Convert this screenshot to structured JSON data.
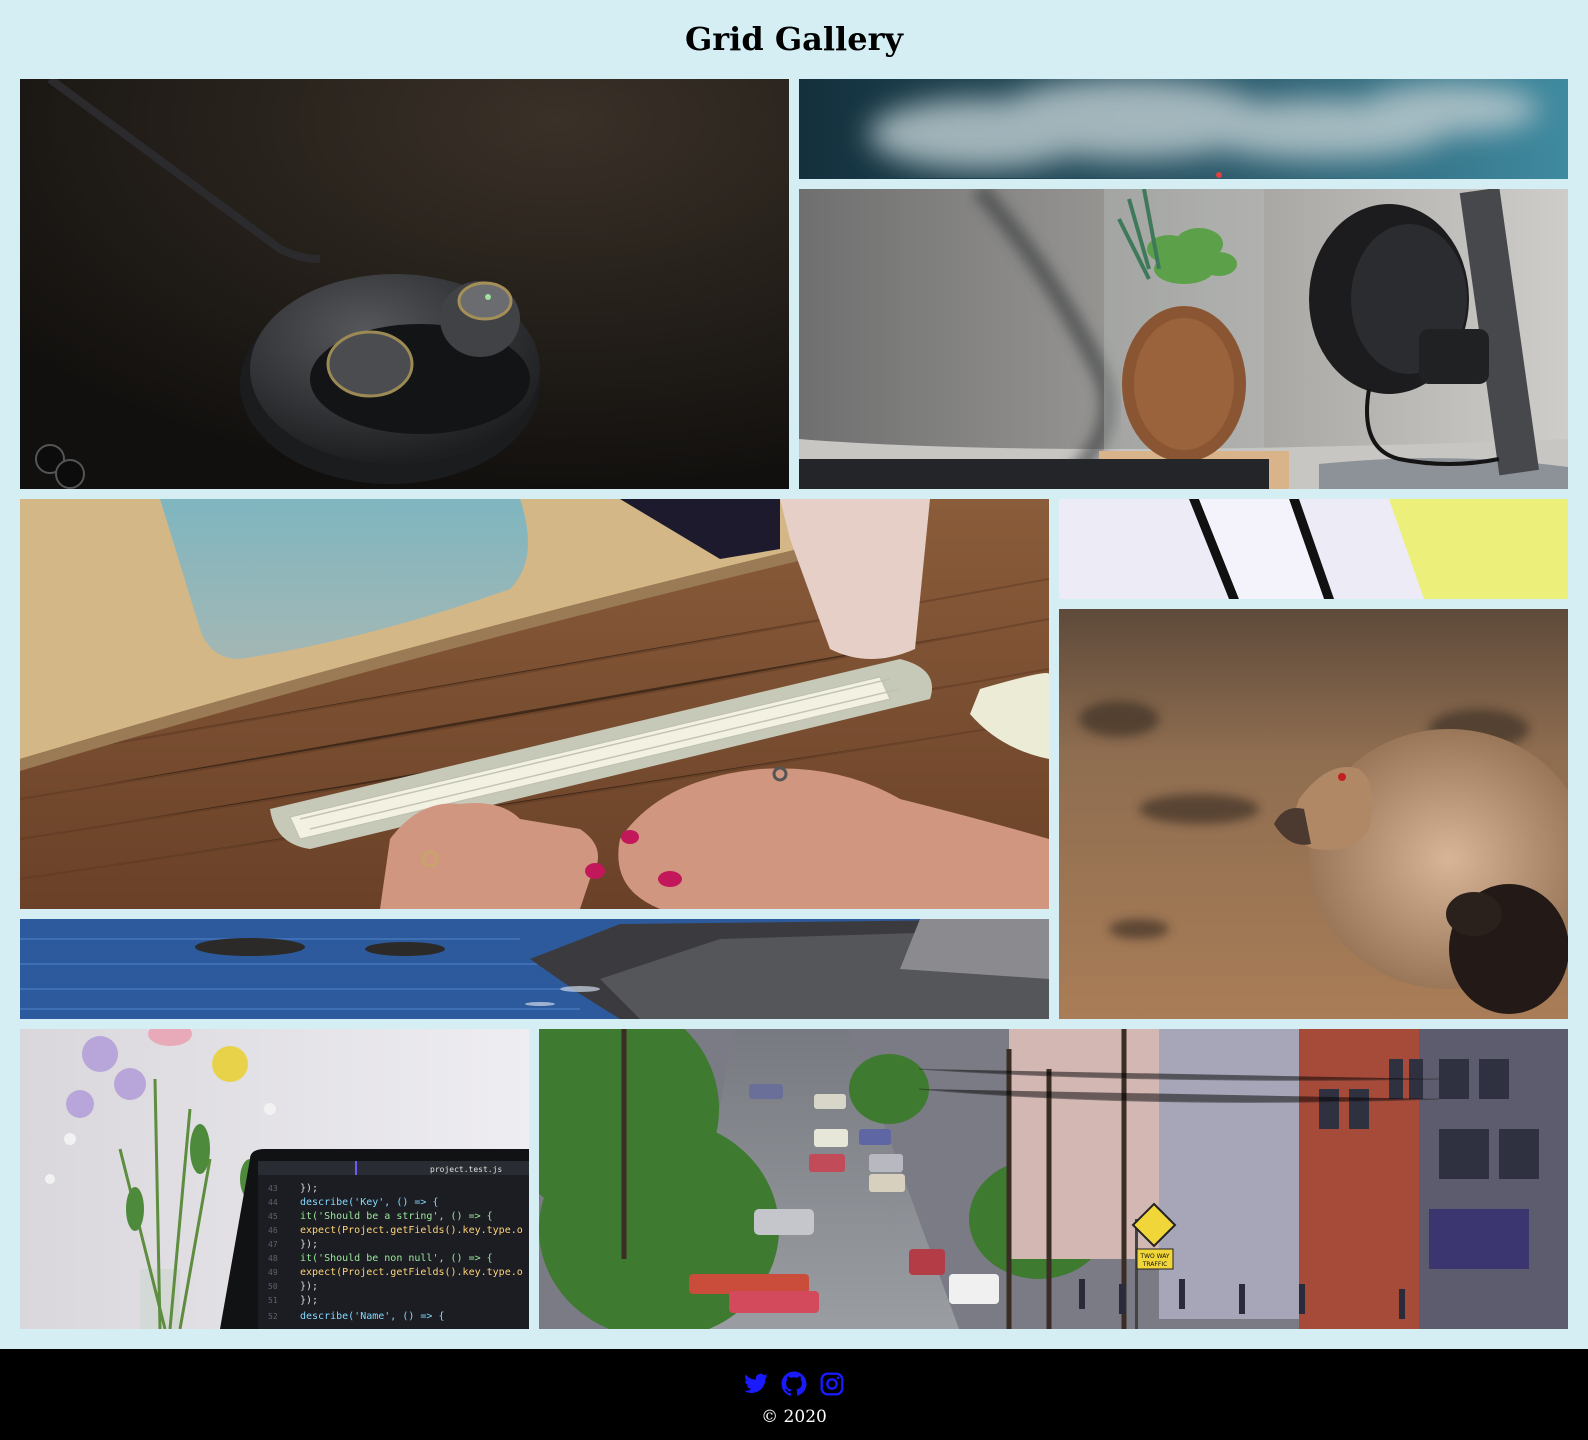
{
  "header": {
    "title": "Grid Gallery"
  },
  "gallery": {
    "tiles": [
      {
        "name": "earbuds-photo",
        "description": "wireless earbuds charging case"
      },
      {
        "name": "smoke-photo",
        "description": "smoke over dark teal background"
      },
      {
        "name": "headphones-plant-photo",
        "description": "headphones on stand beside plant terrarium"
      },
      {
        "name": "keyboard-typing-photo",
        "description": "hands typing on white keyboard on wooden desk"
      },
      {
        "name": "phone-photo",
        "description": "phones on white surface with yellow accent"
      },
      {
        "name": "sheep-photo",
        "description": "woolly sheep in brown field"
      },
      {
        "name": "coast-photo",
        "description": "rocky coastline and blue sea"
      },
      {
        "name": "laptop-code-photo",
        "description": "laptop showing code next to flowers"
      },
      {
        "name": "street-photo",
        "description": "steep city street with cars and houses"
      }
    ],
    "code_lines": [
      "});",
      "describe('Key', () => {",
      "  it('Should be a string', () => {",
      "    expect(Project.getFields().key.type.o",
      "  });",
      "  it('Should be non null', () => {",
      "    expect(Project.getFields().key.type.o",
      "  });",
      "});",
      "describe('Name', () => {"
    ],
    "code_tab": "project.test.js",
    "sign_text": [
      "TWO WAY",
      "TRAFFIC"
    ]
  },
  "footer": {
    "social": [
      {
        "name": "twitter-icon",
        "color": "#1a1aff"
      },
      {
        "name": "github-icon",
        "color": "#1a1aff"
      },
      {
        "name": "instagram-icon",
        "color": "#1a1aff"
      }
    ],
    "copyright": "© 2020"
  }
}
